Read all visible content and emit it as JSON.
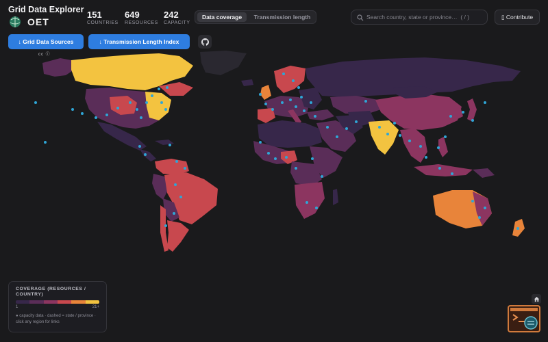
{
  "app": {
    "title": "Grid Data Explorer",
    "logo_text": "OET"
  },
  "stats": [
    {
      "value": "151",
      "label": "COUNTRIES"
    },
    {
      "value": "649",
      "label": "RESOURCES"
    },
    {
      "value": "242",
      "label": "CAPACITY"
    }
  ],
  "view_toggle": {
    "active": "Data coverage",
    "inactive": "Transmission length"
  },
  "search": {
    "placeholder": "Search country, state or province…  ( / )"
  },
  "contribute_label": "Contribute",
  "downloads": {
    "sources_label": "↓ Grid Data Sources",
    "index_label": "↓ Transmission Length Index"
  },
  "license_text": "cc ⓘ",
  "legend": {
    "title": "COVERAGE (RESOURCES / COUNTRY)",
    "min_label": "1",
    "max_label": "21+",
    "note": "● capacity data · dashed = state / province · click any region for links",
    "colors": [
      "#37274a",
      "#5a2d58",
      "#8c3560",
      "#c8484e",
      "#e8843a",
      "#f3c340"
    ]
  },
  "map": {
    "ocean_color": "#1a1a1c",
    "marker_color": "#2fa6d6",
    "no_data_color": "#2a2830"
  }
}
